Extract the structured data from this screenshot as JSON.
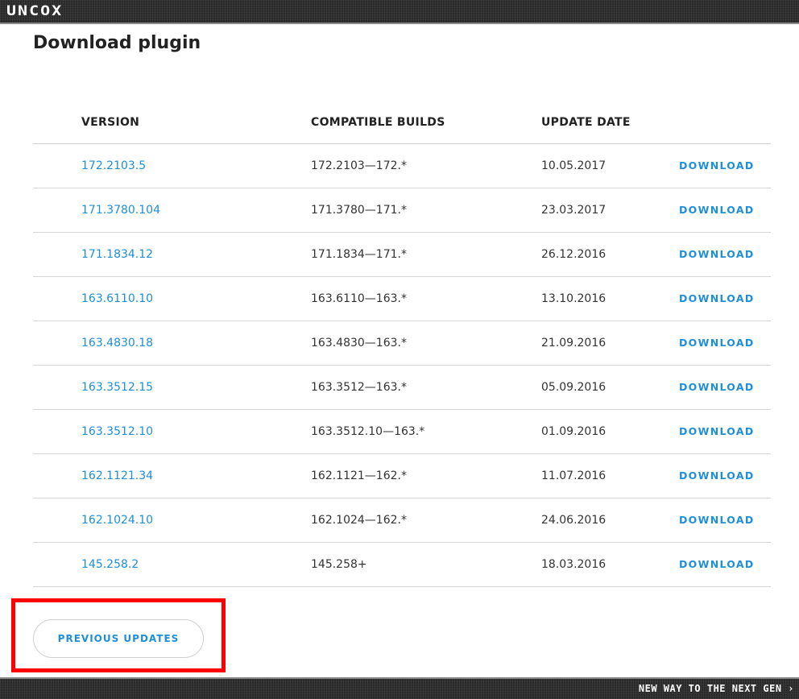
{
  "header": {
    "logo_text": "UNCOX"
  },
  "page": {
    "title": "Download plugin"
  },
  "table": {
    "columns": {
      "version": "VERSION",
      "builds": "COMPATIBLE BUILDS",
      "date": "UPDATE DATE"
    },
    "download_label": "DOWNLOAD",
    "rows": [
      {
        "version": "172.2103.5",
        "builds": "172.2103—172.*",
        "date": "10.05.2017"
      },
      {
        "version": "171.3780.104",
        "builds": "171.3780—171.*",
        "date": "23.03.2017"
      },
      {
        "version": "171.1834.12",
        "builds": "171.1834—171.*",
        "date": "26.12.2016"
      },
      {
        "version": "163.6110.10",
        "builds": "163.6110—163.*",
        "date": "13.10.2016"
      },
      {
        "version": "163.4830.18",
        "builds": "163.4830—163.*",
        "date": "21.09.2016"
      },
      {
        "version": "163.3512.15",
        "builds": "163.3512—163.*",
        "date": "05.09.2016"
      },
      {
        "version": "163.3512.10",
        "builds": "163.3512.10—163.*",
        "date": "01.09.2016"
      },
      {
        "version": "162.1121.34",
        "builds": "162.1121—162.*",
        "date": "11.07.2016"
      },
      {
        "version": "162.1024.10",
        "builds": "162.1024—162.*",
        "date": "24.06.2016"
      },
      {
        "version": "145.258.2",
        "builds": "145.258+",
        "date": "18.03.2016"
      }
    ]
  },
  "previous_updates": {
    "label": "PREVIOUS UPDATES"
  },
  "footer": {
    "tagline": "NEW WAY TO THE NEXT GEN ›"
  },
  "colors": {
    "link": "#1e8fd8",
    "highlight": "#ff0000",
    "bar": "#2a2a2a"
  }
}
